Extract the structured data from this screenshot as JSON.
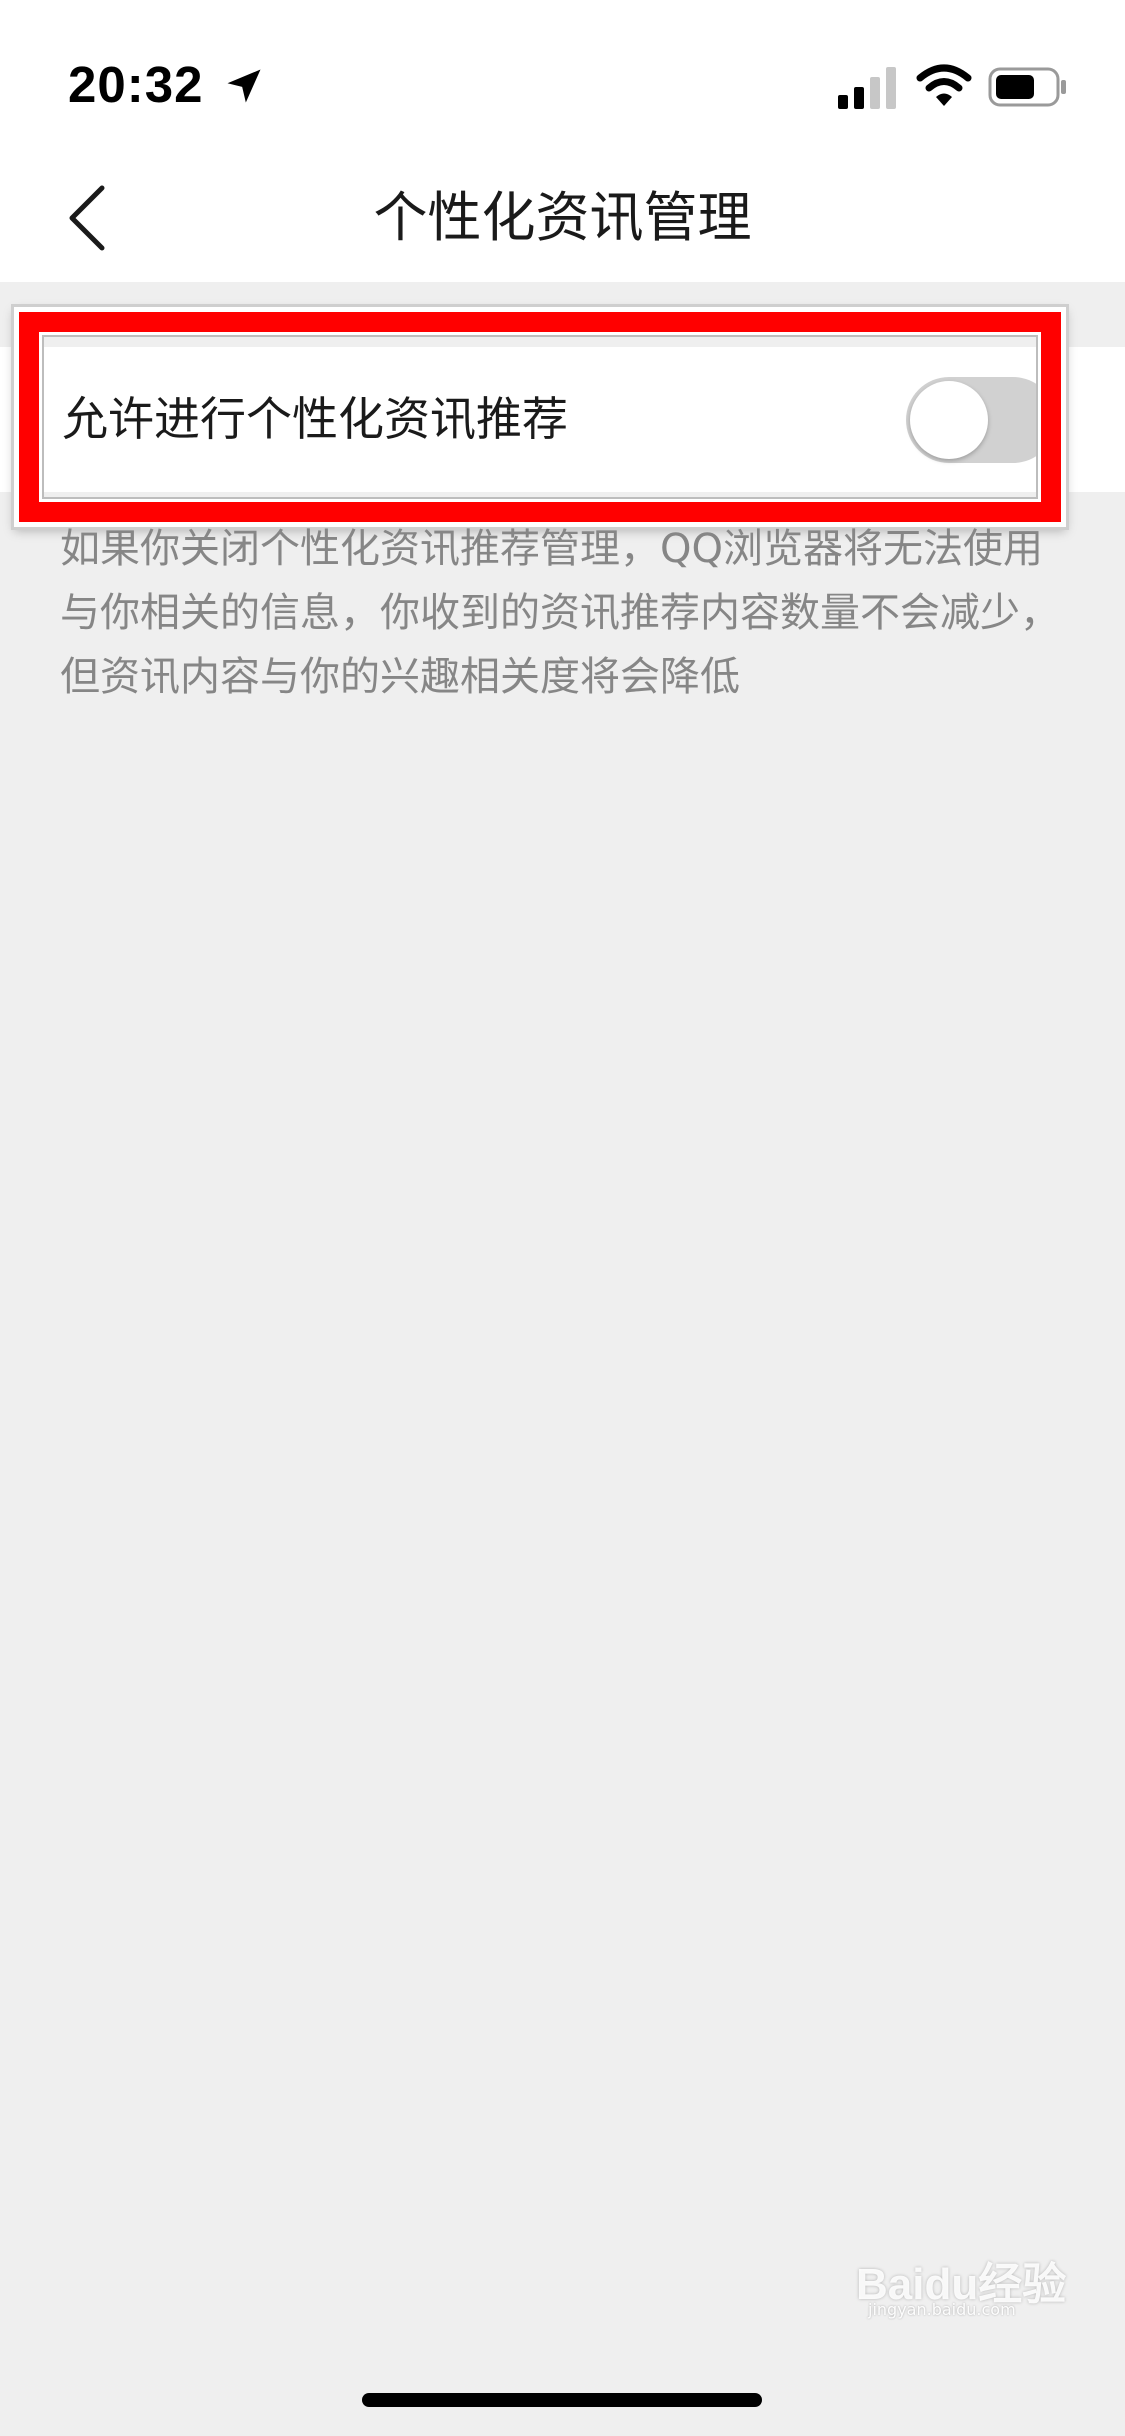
{
  "status_bar": {
    "time": "20:32",
    "icons": [
      "location-arrow-icon",
      "cellular-signal-icon",
      "wifi-icon",
      "battery-icon"
    ]
  },
  "nav_bar": {
    "back_icon": "chevron-left-icon",
    "title": "个性化资讯管理"
  },
  "setting": {
    "label": "允许进行个性化资讯推荐",
    "toggle_state": "off"
  },
  "description": "如果你关闭个性化资讯推荐管理，QQ浏览器将无法使用与你相关的信息，你收到的资讯推荐内容数量不会减少，但资讯内容与你的兴趣相关度将会降低",
  "watermark": {
    "brand": "Baidu经验",
    "url": "jingyan.baidu.com"
  },
  "colors": {
    "highlight": "#ff0000",
    "background": "#efefef",
    "toggle_off": "#d1d1d1",
    "description_text": "#868686"
  }
}
